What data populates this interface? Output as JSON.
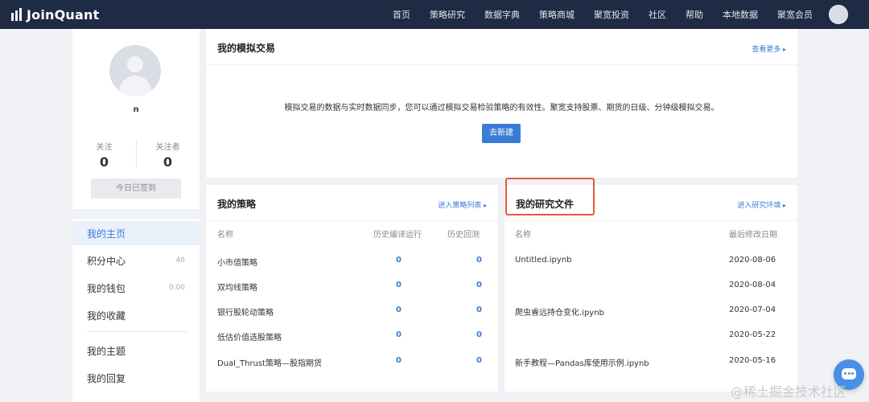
{
  "brand": {
    "name": "JoinQuant"
  },
  "nav": [
    "首页",
    "策略研究",
    "数据字典",
    "策略商城",
    "聚宽投资",
    "社区",
    "帮助",
    "本地数据",
    "聚宽会员"
  ],
  "profile": {
    "name": "n",
    "following_label": "关注",
    "following_count": "0",
    "followers_label": "关注者",
    "followers_count": "0",
    "signin_label": "今日已签到"
  },
  "menu": [
    {
      "label": "我的主页",
      "count": ""
    },
    {
      "label": "积分中心",
      "count": "46"
    },
    {
      "label": "我的钱包",
      "count": "0.00"
    },
    {
      "label": "我的收藏",
      "count": ""
    },
    {
      "label": "我的主题",
      "count": ""
    },
    {
      "label": "我的回复",
      "count": ""
    }
  ],
  "simulation": {
    "title": "我的模拟交易",
    "more_link": "查看更多",
    "description": "模拟交易的数据与实时数据同步，您可以通过模拟交易检验策略的有效性。聚宽支持股票、期货的日级、分钟级模拟交易。",
    "create_button": "去新建"
  },
  "strategies": {
    "title": "我的策略",
    "link": "进入策略列表",
    "headers": [
      "名称",
      "历史编译运行",
      "历史回测"
    ],
    "rows": [
      {
        "name": "小市值策略",
        "runs": "0",
        "backtests": "0"
      },
      {
        "name": "双均线策略",
        "runs": "0",
        "backtests": "0"
      },
      {
        "name": "银行股轮动策略",
        "runs": "0",
        "backtests": "0"
      },
      {
        "name": "低估价值选股策略",
        "runs": "0",
        "backtests": "0"
      },
      {
        "name": "Dual_Thrust策略—股指期货",
        "runs": "0",
        "backtests": "0"
      }
    ]
  },
  "research": {
    "title": "我的研究文件",
    "link": "进入研究环境",
    "headers": [
      "名称",
      "最后修改日期"
    ],
    "rows": [
      {
        "name": "Untitled.ipynb",
        "date": "2020-08-06"
      },
      {
        "name": "",
        "date": "2020-08-04"
      },
      {
        "name": "爬虫睿远持仓变化.ipynb",
        "date": "2020-07-04"
      },
      {
        "name": "",
        "date": "2020-05-22"
      },
      {
        "name": "新手教程—Pandas库使用示例.ipynb",
        "date": "2020-05-16"
      }
    ]
  },
  "watermark": "@稀土掘金技术社区",
  "colors": {
    "nav_bg": "#1f2a44",
    "accent": "#3a7bd5",
    "highlight": "#e25a3a",
    "page_bg": "#f1f2f6"
  }
}
